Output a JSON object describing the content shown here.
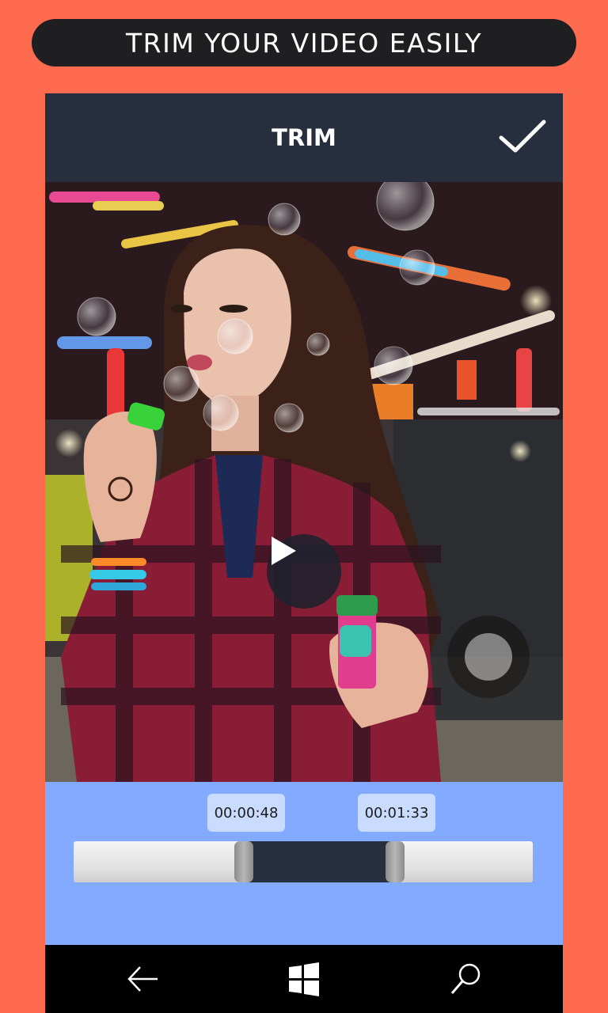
{
  "banner": {
    "text": "TRIM YOUR VIDEO EASILY"
  },
  "appbar": {
    "title": "TRIM",
    "confirm_icon": "checkmark-icon"
  },
  "preview": {
    "play_icon": "play-icon"
  },
  "trim": {
    "start_time": "00:00:48",
    "end_time": "00:01:33",
    "selection_start_fraction": 0.37,
    "selection_end_fraction": 0.7
  },
  "navbar": {
    "back_icon": "back-arrow-icon",
    "home_icon": "windows-logo-icon",
    "search_icon": "search-icon"
  },
  "colors": {
    "background": "#FF6B4E",
    "appbar": "#272E3E",
    "trim_panel": "#82AAFF",
    "chip": "#C9DBFF"
  }
}
